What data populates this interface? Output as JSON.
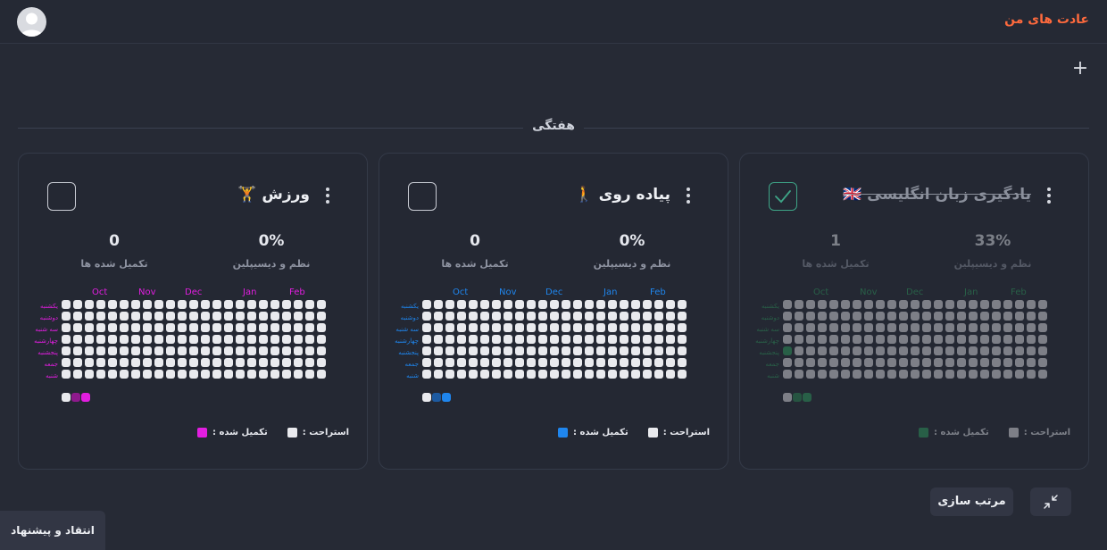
{
  "header": {
    "app_title": "عادت های من"
  },
  "add_button": "+",
  "section": {
    "title": "هفتگی"
  },
  "habits": [
    {
      "title": "ورزش 🏋️",
      "completed_today": false,
      "discipline_value": "0%",
      "discipline_label": "نظم و دیسیپلین",
      "completed_value": "0",
      "completed_label": "تکمیل شده ها",
      "accent_color": "#e21ee0",
      "months": [
        "Oct",
        "Nov",
        "Dec",
        "Jan",
        "Feb"
      ],
      "days": [
        "یکشنبه",
        "دوشنبه",
        "سه شنبه",
        "چهارشنبه",
        "پنجشنبه",
        "جمعه",
        "شنبه"
      ],
      "scale_colors": [
        "#e9eaee",
        "#8e1a8c",
        "#e21ee0"
      ],
      "legend": {
        "rest_label": "استراحت :",
        "rest_color": "#e9eaee",
        "done_label": "تکمیل شده :",
        "done_color": "#e21ee0"
      },
      "filled_cells": []
    },
    {
      "title": "پیاده روی 🚶",
      "completed_today": false,
      "discipline_value": "0%",
      "discipline_label": "نظم و دیسیپلین",
      "completed_value": "0",
      "completed_label": "تکمیل شده ها",
      "accent_color": "#1f86ee",
      "months": [
        "Oct",
        "Nov",
        "Dec",
        "Jan",
        "Feb"
      ],
      "days": [
        "یکشنبه",
        "دوشنبه",
        "سه شنبه",
        "چهارشنبه",
        "پنجشنبه",
        "جمعه",
        "شنبه"
      ],
      "scale_colors": [
        "#e9eaee",
        "#1d5aa0",
        "#1f86ee"
      ],
      "legend": {
        "rest_label": "استراحت :",
        "rest_color": "#e9eaee",
        "done_label": "تکمیل شده :",
        "done_color": "#1f86ee"
      },
      "filled_cells": []
    },
    {
      "title": "یادگیری زبان انگلیسی 🇬🇧",
      "completed_today": true,
      "discipline_value": "33%",
      "discipline_label": "نظم و دیسیپلین",
      "completed_value": "1",
      "completed_label": "تکمیل شده ها",
      "accent_color": "#2ea360",
      "months": [
        "Oct",
        "Nov",
        "Dec",
        "Jan",
        "Feb"
      ],
      "days": [
        "یکشنبه",
        "دوشنبه",
        "سه شنبه",
        "چهارشنبه",
        "پنجشنبه",
        "جمعه",
        "شنبه"
      ],
      "scale_colors": [
        "#e9eaee",
        "#2a8a52",
        "#2ea360"
      ],
      "legend": {
        "rest_label": "استراحت :",
        "rest_color": "#e9eaee",
        "done_label": "تکمیل شده :",
        "done_color": "#2ea360"
      },
      "filled_cells": [
        {
          "week": 0,
          "day": 4
        }
      ]
    }
  ],
  "toolbar": {
    "sort_label": "مرتب سازی",
    "collapse_icon": "collapse-icon"
  },
  "feedback_label": "انتقاد و پیشنهاد"
}
